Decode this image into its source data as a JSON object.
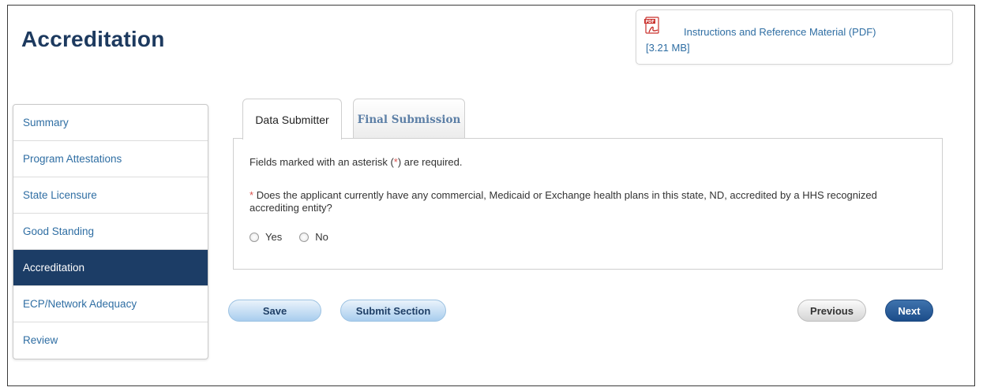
{
  "page": {
    "title": "Accreditation"
  },
  "pdf": {
    "link_text": "Instructions and Reference Material (PDF)",
    "size": "[3.21 MB]",
    "icon": "pdf-icon"
  },
  "sidebar": {
    "items": [
      {
        "label": "Summary"
      },
      {
        "label": "Program Attestations"
      },
      {
        "label": "State Licensure"
      },
      {
        "label": "Good Standing"
      },
      {
        "label": "Accreditation",
        "active": true
      },
      {
        "label": "ECP/Network Adequacy"
      },
      {
        "label": "Review"
      }
    ]
  },
  "tabs": [
    {
      "label": "Data Submitter",
      "active": true
    },
    {
      "label": "Final Submission",
      "active": false
    }
  ],
  "form": {
    "required_prefix": "Fields marked with an asterisk (",
    "required_star": "*",
    "required_suffix": ") are required.",
    "question_star": "*",
    "question": "Does the applicant currently have any commercial, Medicaid or Exchange health plans in this state, ND, accredited by a HHS recognized accrediting entity?",
    "options": [
      {
        "label": "Yes"
      },
      {
        "label": "No"
      }
    ]
  },
  "buttons": {
    "save": "Save",
    "submit_section": "Submit Section",
    "previous": "Previous",
    "next": "Next"
  },
  "colors": {
    "navy": "#1c3d66",
    "link": "#2f6ea3",
    "required": "#d9534f"
  }
}
